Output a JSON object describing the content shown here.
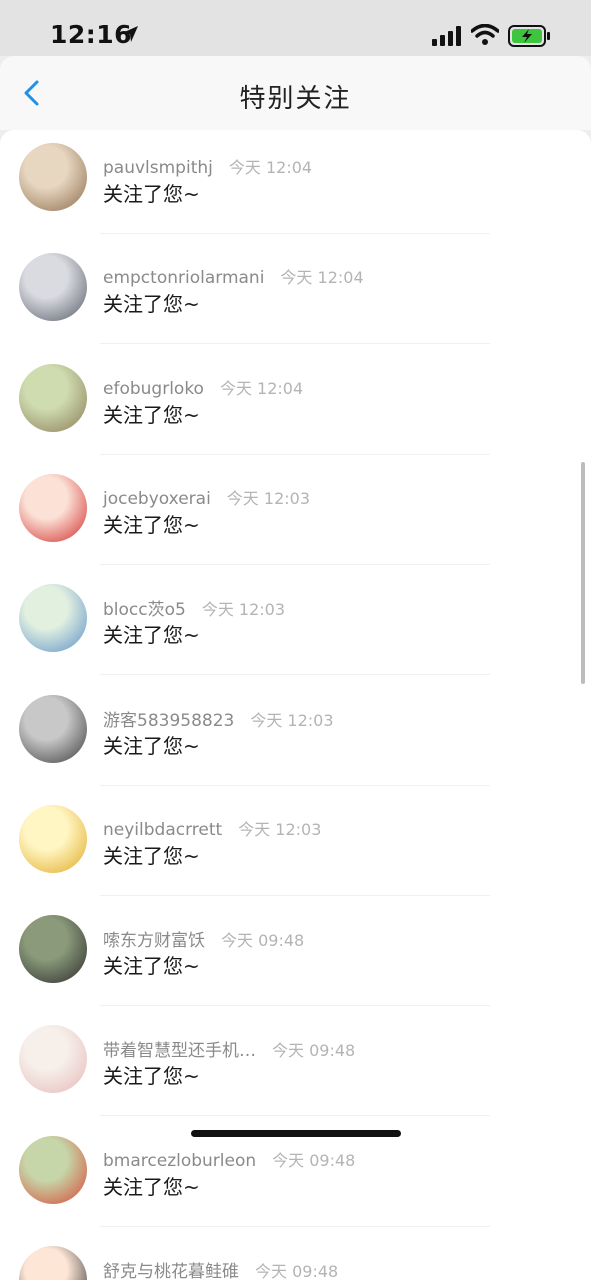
{
  "status": {
    "time": "12:16"
  },
  "header": {
    "title": "特别关注"
  },
  "rows": [
    {
      "name": "pauvlsmpithj",
      "time": "今天 12:04",
      "msg": "关注了您~",
      "avatar_colors": [
        "#e7d6c0",
        "#8a6a4a"
      ]
    },
    {
      "name": "empctonriolarmani",
      "time": "今天 12:04",
      "msg": "关注了您~",
      "avatar_colors": [
        "#d9dbe0",
        "#555a66"
      ]
    },
    {
      "name": "efobugrloko",
      "time": "今天 12:04",
      "msg": "关注了您~",
      "avatar_colors": [
        "#cfdcb0",
        "#8a7a54"
      ]
    },
    {
      "name": "jocebyoxerai",
      "time": "今天 12:03",
      "msg": "关注了您~",
      "avatar_colors": [
        "#fbe1d6",
        "#d02828"
      ]
    },
    {
      "name": "blocc茨o5",
      "time": "今天 12:03",
      "msg": "关注了您~",
      "avatar_colors": [
        "#e2f0e0",
        "#5a8fc8"
      ]
    },
    {
      "name": "游客583958823",
      "time": "今天 12:03",
      "msg": "关注了您~",
      "avatar_colors": [
        "#c8c8c8",
        "#3a3a3a"
      ]
    },
    {
      "name": "neyilbdacrrett",
      "time": "今天 12:03",
      "msg": "关注了您~",
      "avatar_colors": [
        "#fff6c4",
        "#e0a820"
      ]
    },
    {
      "name": "嗦东方财富饫",
      "time": "今天 09:48",
      "msg": "关注了您~",
      "avatar_colors": [
        "#8a9a7a",
        "#2a2a2a"
      ]
    },
    {
      "name": "带着智慧型还手机…",
      "time": "今天 09:48",
      "msg": "关注了您~",
      "avatar_colors": [
        "#f6efea",
        "#e6b8b8"
      ]
    },
    {
      "name": "bmarcezloburleon",
      "time": "今天 09:48",
      "msg": "关注了您~",
      "avatar_colors": [
        "#c6d6a8",
        "#d84434"
      ]
    },
    {
      "name": "舒克与桃花暮鲑碓",
      "time": "今天 09:48",
      "msg": "",
      "avatar_colors": [
        "#fde6d6",
        "#222222"
      ]
    }
  ],
  "colors": {
    "accent": "#1e90e8"
  }
}
